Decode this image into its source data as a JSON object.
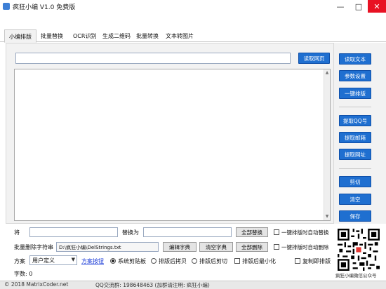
{
  "window": {
    "title": "疯狂小编 V1.0 免费版"
  },
  "title_buttons": {
    "minimize": "—",
    "maximize": "□",
    "close": "✕"
  },
  "tabs": [
    {
      "label": "小编排版",
      "active": true
    },
    {
      "label": "批量替换",
      "active": false
    },
    {
      "label": "OCR识别",
      "active": false
    },
    {
      "label": "生成二维码",
      "active": false
    },
    {
      "label": "批量转换",
      "active": false
    },
    {
      "label": "文本转图片",
      "active": false
    }
  ],
  "main": {
    "url_value": "",
    "read_web_label": "读取网页"
  },
  "right_buttons": {
    "read_text": "读取文本",
    "param_settings": "参数设置",
    "one_key_format": "一键排版",
    "extract_qq": "提取QQ号",
    "extract_email": "提取邮箱",
    "extract_url": "提取网址",
    "cut": "剪切",
    "clear": "清空",
    "save": "保存"
  },
  "bottom": {
    "replace_from_label": "将",
    "replace_to_label": "替换为",
    "replace_from_value": "",
    "replace_to_value": "",
    "replace_all_button": "全部替换",
    "auto_replace_label": "一键排版时自动替换",
    "delete_strings_label": "批量删除字符串",
    "delete_file_value": "D:\\疯狂小编\\DelStrings.txt",
    "edit_dict_button": "编辑字典",
    "clear_dict_button": "清空字典",
    "delete_all_button": "全部删除",
    "auto_delete_label": "一键排版时自动删除",
    "scheme_label": "方案",
    "scheme_selected": "用户定义",
    "scheme_link": "方案按钮",
    "radio_options": [
      {
        "label": "系统剪贴板",
        "checked": true
      },
      {
        "label": "排版后拷贝",
        "checked": false
      },
      {
        "label": "排版后剪切",
        "checked": false
      }
    ],
    "minimize_after_label": "排版后最小化",
    "copy_to_format_label": "复制即排版",
    "char_count": "字数: 0"
  },
  "status": {
    "copyright": "© 2018 MatrixCoder.net",
    "qq_group": "QQ交流群: 198648463 (加群请注明: 疯狂小编)"
  },
  "qr": {
    "caption": "疯狂小编微信公众号"
  },
  "colors": {
    "blue_button": "#1f6fd0",
    "panel_bg": "#f2f2f2"
  }
}
